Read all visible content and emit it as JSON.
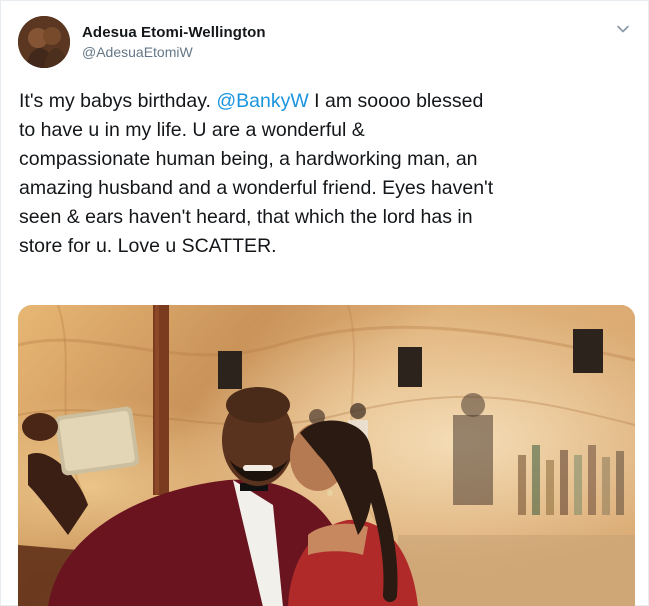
{
  "tweet": {
    "author": {
      "display_name": "Adesua Etomi-Wellington",
      "handle": "@AdesuaEtomiW",
      "avatar_icon": "profile-photo"
    },
    "menu_icon": "chevron-down-icon",
    "text": {
      "before_mention": "It's my babys birthday. ",
      "mention": "@BankyW",
      "after_mention": " I am soooo blessed\nto have u in my life. U are a wonderful &\ncompassionate human being, a hardworking man, an\namazing husband and a wonderful friend. Eyes haven't\nseen & ears haven't heard, that which the lord has in\nstore for u. Love u SCATTER."
    },
    "media": {
      "type": "photo"
    }
  },
  "colors": {
    "text_primary": "#14171a",
    "text_secondary": "#657786",
    "link": "#1b95e0",
    "border": "#e6ecf0"
  }
}
